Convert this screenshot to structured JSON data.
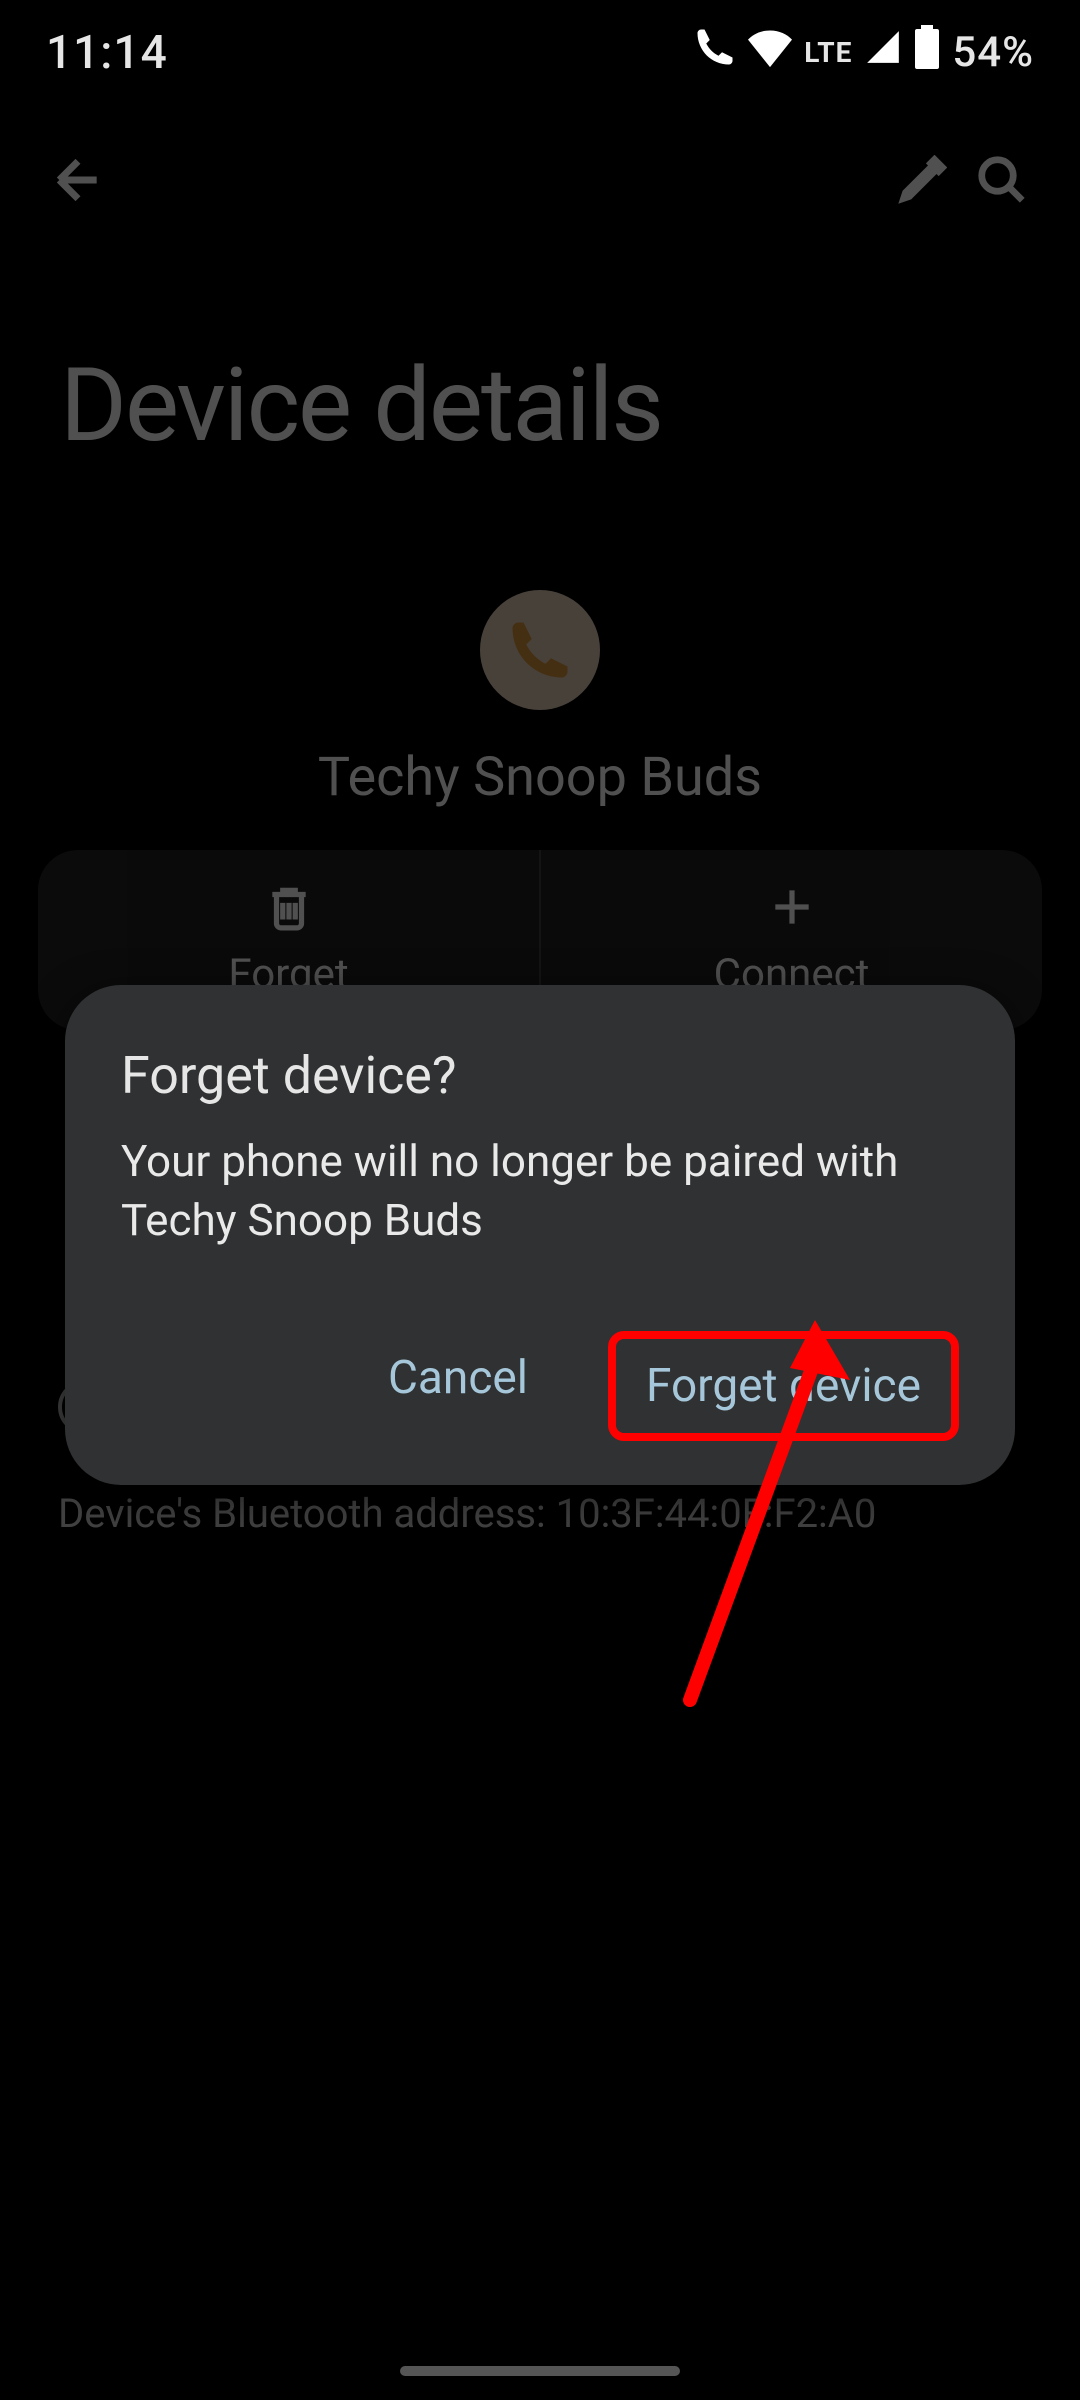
{
  "status": {
    "time": "11:14",
    "network_label": "LTE",
    "battery": "54%"
  },
  "page": {
    "title": "Device details"
  },
  "device": {
    "name": "Techy Snoop Buds"
  },
  "actions": {
    "forget": "Forget",
    "connect": "Connect"
  },
  "bt_address_label": "Device's Bluetooth address: 10:3F:44:0F:F2:A0",
  "dialog": {
    "title": "Forget device?",
    "message": "Your phone will no longer be paired with Techy Snoop Buds",
    "cancel": "Cancel",
    "confirm": "Forget device"
  }
}
